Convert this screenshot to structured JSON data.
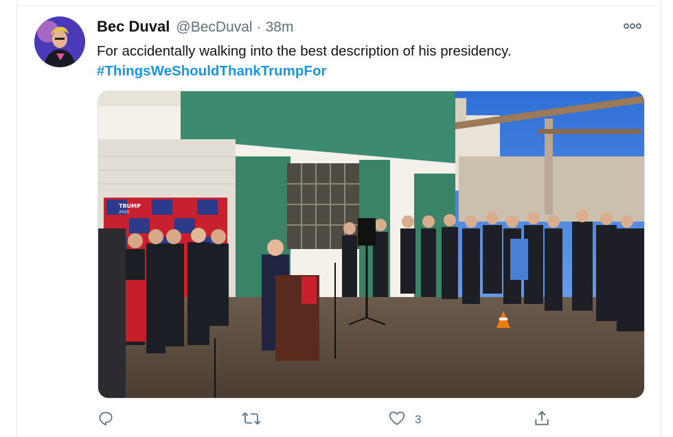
{
  "tweet": {
    "display_name": "Bec Duval",
    "handle": "@BecDuval",
    "separator": "·",
    "time": "38m",
    "text": "For accidentally walking into the best description of his presidency.",
    "hashtag": "#ThingsWeShouldThankTrumpFor",
    "media": {
      "sign_text": "TRUMP",
      "sign_year": "2020"
    }
  },
  "actions": {
    "reply_count": "",
    "retweet_count": "",
    "like_count": "3",
    "share_count": ""
  },
  "colors": {
    "text": "#0f1419",
    "secondary": "#5b7083",
    "link": "#1b95e0",
    "sign_red": "#c8202f",
    "sign_blue": "#2b3a8a"
  },
  "icons": {
    "more": "more-horizontal-icon",
    "reply": "reply-icon",
    "retweet": "retweet-icon",
    "like": "like-heart-icon",
    "share": "share-icon"
  }
}
